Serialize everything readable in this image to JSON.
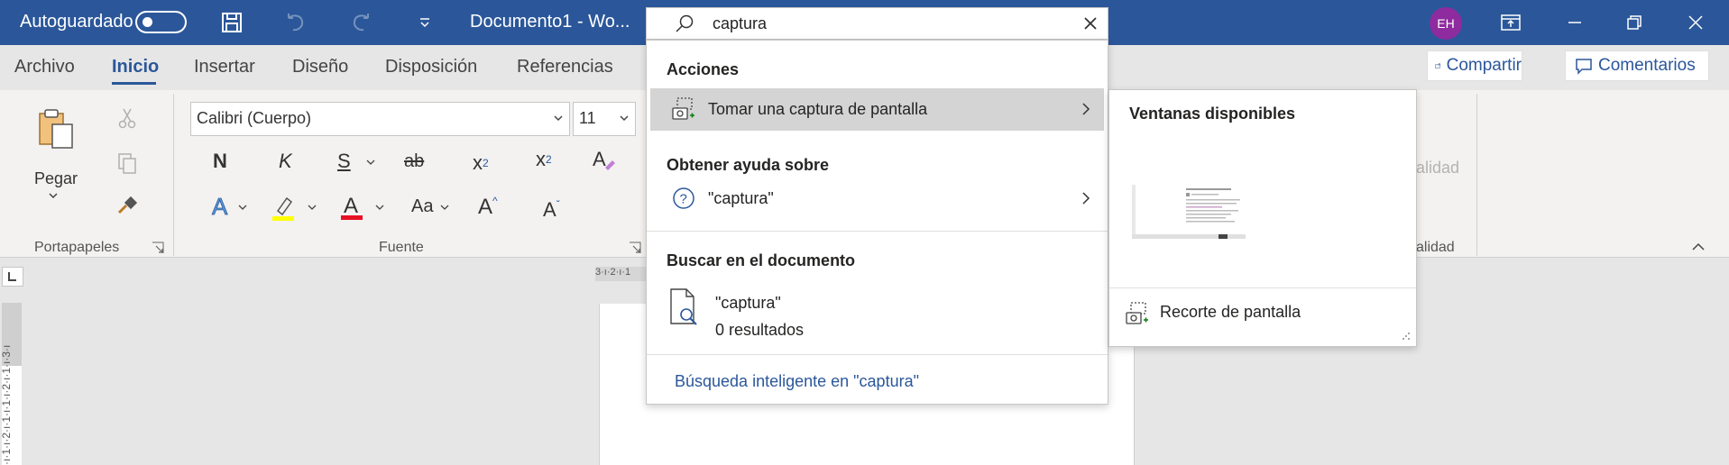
{
  "titlebar": {
    "autosave_label": "Autoguardado",
    "doc_name": "Documento1  -  Wo...",
    "user_initials": "EH",
    "colors": {
      "brand": "#2b579a",
      "avatar": "#8e2b9e"
    }
  },
  "search": {
    "value": "captura"
  },
  "tabs": [
    {
      "label": "Archivo"
    },
    {
      "label": "Inicio",
      "active": true
    },
    {
      "label": "Insertar"
    },
    {
      "label": "Diseño"
    },
    {
      "label": "Disposición"
    },
    {
      "label": "Referencias"
    }
  ],
  "actions": {
    "share_label": "Compartir",
    "comments_label": "Comentarios"
  },
  "ribbon": {
    "clipboard": {
      "paste_label": "Pegar",
      "group_label": "Portapapeles"
    },
    "font": {
      "font_name": "Calibri (Cuerpo)",
      "font_size": "11",
      "group_label": "Fuente",
      "bold": "N",
      "italic": "K",
      "underline": "S",
      "strike": "ab",
      "subscript": "x",
      "superscript": "x",
      "change_case": "Aa",
      "grow": "A",
      "shrink": "A"
    },
    "hidden_group": {
      "button_partial": "alidad",
      "label_partial": "alidad"
    }
  },
  "dropdown": {
    "section_actions": "Acciones",
    "screenshot_item": "Tomar una captura de pantalla",
    "section_help": "Obtener ayuda sobre",
    "help_item": "\"captura\"",
    "section_doc": "Buscar en el documento",
    "doc_query": "\"captura\"",
    "doc_results": "0 resultados",
    "smart_lookup": "Búsqueda inteligente en \"captura\""
  },
  "submenu": {
    "heading": "Ventanas disponibles",
    "clip_item": "Recorte de pantalla"
  },
  "ruler": {
    "horizontal_text": "3·ı·2·ı·1",
    "vertical_text": "·ı·1·ı·2·ı·1·ı·1·ı·2·ı·1·ı·3·ı"
  }
}
